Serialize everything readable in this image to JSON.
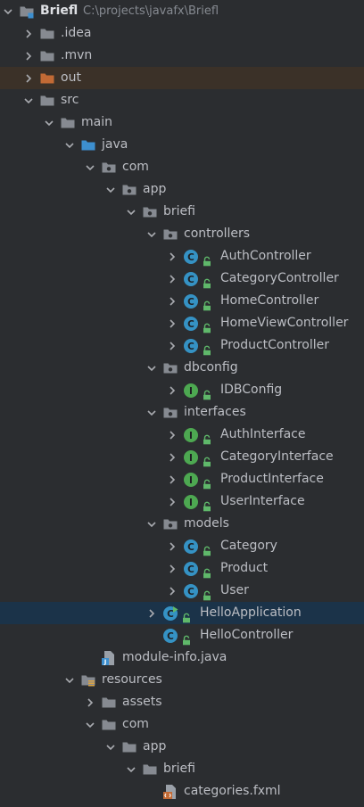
{
  "project": {
    "name": "Briefl",
    "path": "C:\\projects\\javafx\\Briefl"
  },
  "colors": {
    "background": "#2b2d30",
    "selected_row": "#1b3349",
    "class_icon": "#3592c4",
    "interface_icon": "#4da851",
    "folder": "#868a91",
    "source_folder": "#3d8fcf",
    "excluded_folder": "#c26a35",
    "lock": "#5fb86a"
  },
  "tree": [
    {
      "label": "Briefl",
      "path": "C:\\projects\\javafx\\Briefl",
      "icon": "module-folder-icon",
      "depth": 0,
      "chevron": "down",
      "bold": true
    },
    {
      "label": ".idea",
      "icon": "folder-icon",
      "depth": 1,
      "chevron": "right"
    },
    {
      "label": ".mvn",
      "icon": "folder-icon",
      "depth": 1,
      "chevron": "right"
    },
    {
      "label": "out",
      "icon": "excluded-folder-icon",
      "depth": 1,
      "chevron": "right",
      "highlighted": true
    },
    {
      "label": "src",
      "icon": "folder-icon",
      "depth": 1,
      "chevron": "down"
    },
    {
      "label": "main",
      "icon": "folder-icon",
      "depth": 2,
      "chevron": "down"
    },
    {
      "label": "java",
      "icon": "source-folder-icon",
      "depth": 3,
      "chevron": "down"
    },
    {
      "label": "com",
      "icon": "package-icon",
      "depth": 4,
      "chevron": "down"
    },
    {
      "label": "app",
      "icon": "package-icon",
      "depth": 5,
      "chevron": "down"
    },
    {
      "label": "briefi",
      "icon": "package-icon",
      "depth": 6,
      "chevron": "down"
    },
    {
      "label": "controllers",
      "icon": "package-icon",
      "depth": 7,
      "chevron": "down"
    },
    {
      "label": "AuthController",
      "icon": "class-icon",
      "depth": 8,
      "chevron": "right",
      "lock": true
    },
    {
      "label": "CategoryController",
      "icon": "class-icon",
      "depth": 8,
      "chevron": "right",
      "lock": true
    },
    {
      "label": "HomeController",
      "icon": "class-icon",
      "depth": 8,
      "chevron": "right",
      "lock": true
    },
    {
      "label": "HomeViewController",
      "icon": "class-icon",
      "depth": 8,
      "chevron": "right",
      "lock": true
    },
    {
      "label": "ProductController",
      "icon": "class-icon",
      "depth": 8,
      "chevron": "right",
      "lock": true
    },
    {
      "label": "dbconfig",
      "icon": "package-icon",
      "depth": 7,
      "chevron": "down"
    },
    {
      "label": "IDBConfig",
      "icon": "interface-icon",
      "depth": 8,
      "chevron": "right",
      "lock": true
    },
    {
      "label": "interfaces",
      "icon": "package-icon",
      "depth": 7,
      "chevron": "down"
    },
    {
      "label": "AuthInterface",
      "icon": "interface-icon",
      "depth": 8,
      "chevron": "right",
      "lock": true
    },
    {
      "label": "CategoryInterface",
      "icon": "interface-icon",
      "depth": 8,
      "chevron": "right",
      "lock": true
    },
    {
      "label": "ProductInterface",
      "icon": "interface-icon",
      "depth": 8,
      "chevron": "right",
      "lock": true
    },
    {
      "label": "UserInterface",
      "icon": "interface-icon",
      "depth": 8,
      "chevron": "right",
      "lock": true
    },
    {
      "label": "models",
      "icon": "package-icon",
      "depth": 7,
      "chevron": "down"
    },
    {
      "label": "Category",
      "icon": "class-icon",
      "depth": 8,
      "chevron": "right",
      "lock": true
    },
    {
      "label": "Product",
      "icon": "class-icon",
      "depth": 8,
      "chevron": "right",
      "lock": true
    },
    {
      "label": "User",
      "icon": "class-icon",
      "depth": 8,
      "chevron": "right",
      "lock": true
    },
    {
      "label": "HelloApplication",
      "icon": "runnable-class-icon",
      "depth": 7,
      "chevron": "right",
      "lock": true,
      "selected": true
    },
    {
      "label": "HelloController",
      "icon": "class-icon",
      "depth": 7,
      "chevron": "none",
      "lock": true
    },
    {
      "label": "module-info.java",
      "icon": "java-file-icon",
      "depth": 4,
      "chevron": "none"
    },
    {
      "label": "resources",
      "icon": "resources-folder-icon",
      "depth": 3,
      "chevron": "down"
    },
    {
      "label": "assets",
      "icon": "folder-icon",
      "depth": 4,
      "chevron": "right"
    },
    {
      "label": "com",
      "icon": "folder-icon",
      "depth": 4,
      "chevron": "down"
    },
    {
      "label": "app",
      "icon": "folder-icon",
      "depth": 5,
      "chevron": "down"
    },
    {
      "label": "briefi",
      "icon": "folder-icon",
      "depth": 6,
      "chevron": "down"
    },
    {
      "label": "categories.fxml",
      "icon": "fxml-file-icon",
      "depth": 7,
      "chevron": "none"
    },
    {
      "label": "",
      "icon": "fxml-file-icon",
      "depth": 7,
      "chevron": "none"
    }
  ]
}
